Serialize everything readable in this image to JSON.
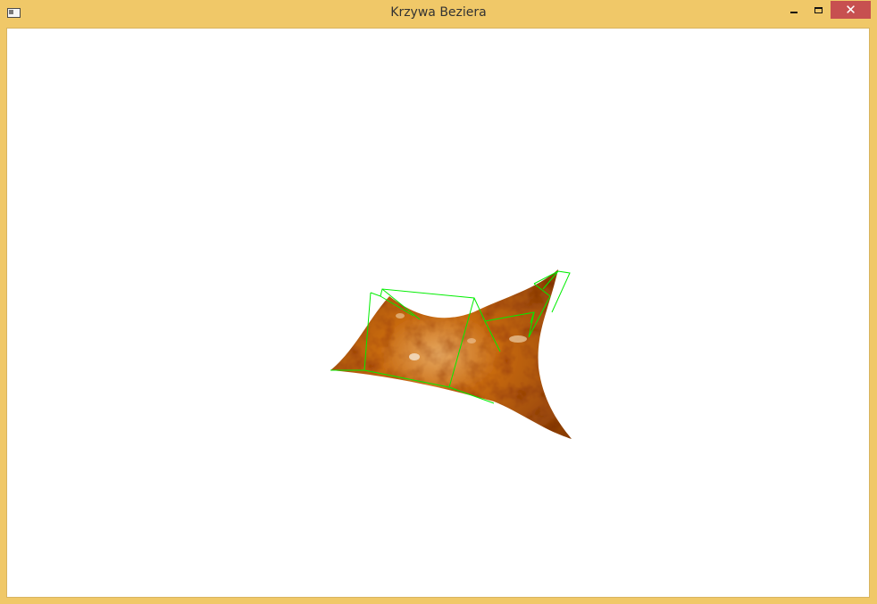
{
  "window": {
    "title": "Krzywa Beziera",
    "close_label": "✕"
  },
  "colors": {
    "frame": "#f0c868",
    "close_button": "#c75050",
    "surface_dark": "#8a3c05",
    "surface_mid": "#c86a10",
    "surface_light": "#e6a860",
    "control_net": "#00ee00"
  },
  "icons": {
    "app": "window-app-icon",
    "minimize": "minimize-icon",
    "maximize": "maximize-icon",
    "close": "close-icon"
  }
}
